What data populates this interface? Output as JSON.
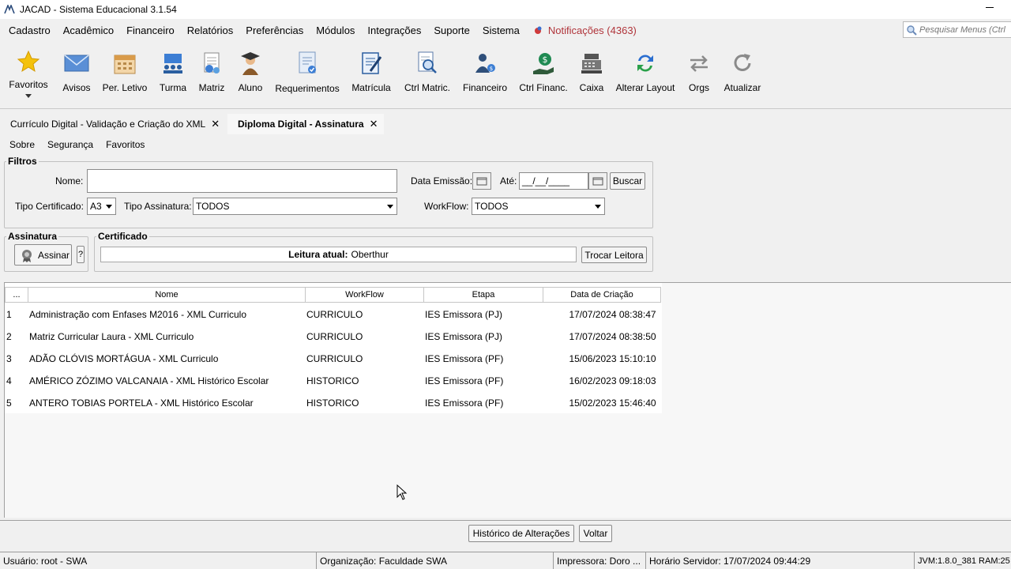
{
  "window": {
    "title": "JACAD - Sistema Educacional 3.1.54"
  },
  "menu": {
    "items": [
      "Cadastro",
      "Acadêmico",
      "Financeiro",
      "Relatórios",
      "Preferências",
      "Módulos",
      "Integrações",
      "Suporte",
      "Sistema"
    ],
    "notifications": "Notificações (4363)",
    "search_placeholder": "Pesquisar Menus (Ctrl"
  },
  "toolbar": {
    "favorites": "Favoritos",
    "buttons": [
      "Avisos",
      "Per. Letivo",
      "Turma",
      "Matriz",
      "Aluno",
      "Requerimentos",
      "Matrícula",
      "Ctrl Matric.",
      "Financeiro",
      "Ctrl Financ.",
      "Caixa",
      "Alterar Layout",
      "Orgs",
      "Atualizar"
    ]
  },
  "tabs": [
    {
      "label": "Currículo Digital - Validação e Criação do XML",
      "active": false
    },
    {
      "label": "Diploma Digital - Assinatura",
      "active": true
    }
  ],
  "submenu": [
    "Sobre",
    "Segurança",
    "Favoritos"
  ],
  "filters": {
    "legend": "Filtros",
    "name_label": "Nome:",
    "name_value": "",
    "emission_label": "Data Emissão:",
    "until_label": "Até:",
    "until_value": "__/__/____",
    "search_button": "Buscar",
    "cert_type_label": "Tipo Certificado:",
    "cert_type_value": "A3",
    "sign_type_label": "Tipo Assinatura:",
    "sign_type_value": "TODOS",
    "workflow_label": "WorkFlow:",
    "workflow_value": "TODOS"
  },
  "signature": {
    "legend": "Assinatura",
    "sign_button": "Assinar",
    "help_button": "?"
  },
  "certificate": {
    "legend": "Certificado",
    "reader_label": "Leitura atual:",
    "reader_value": "Oberthur",
    "change_button": "Trocar Leitora"
  },
  "table": {
    "columns": [
      "...",
      "Nome",
      "WorkFlow",
      "Etapa",
      "Data de Criação"
    ],
    "rows": [
      {
        "n": "1",
        "nome": "Administração com Enfases M2016 - XML Curriculo",
        "workflow": "CURRICULO",
        "etapa": "IES Emissora (PJ)",
        "data": "17/07/2024 08:38:47"
      },
      {
        "n": "2",
        "nome": "Matriz Curricular Laura - XML Curriculo",
        "workflow": "CURRICULO",
        "etapa": "IES Emissora (PJ)",
        "data": "17/07/2024 08:38:50"
      },
      {
        "n": "3",
        "nome": "ADÃO CLÓVIS MORTÁGUA - XML Curriculo",
        "workflow": "CURRICULO",
        "etapa": "IES Emissora (PF)",
        "data": "15/06/2023 15:10:10"
      },
      {
        "n": "4",
        "nome": "AMÉRICO ZÓZIMO VALCANAIA - XML Histórico Escolar",
        "workflow": "HISTORICO",
        "etapa": "IES Emissora (PF)",
        "data": "16/02/2023 09:18:03"
      },
      {
        "n": "5",
        "nome": "ANTERO TOBIAS PORTELA - XML Histórico Escolar",
        "workflow": "HISTORICO",
        "etapa": "IES Emissora (PF)",
        "data": "15/02/2023 15:46:40"
      }
    ]
  },
  "footer": {
    "history_button": "Histórico de Alterações",
    "back_button": "Voltar"
  },
  "status": {
    "user": "Usuário: root - SWA",
    "org": "Organização: Faculdade SWA",
    "printer": "Impressora: Doro ...",
    "server_time": "Horário Servidor: 17/07/2024 09:44:29",
    "jvm": "JVM:1.8.0_381  RAM:25"
  }
}
